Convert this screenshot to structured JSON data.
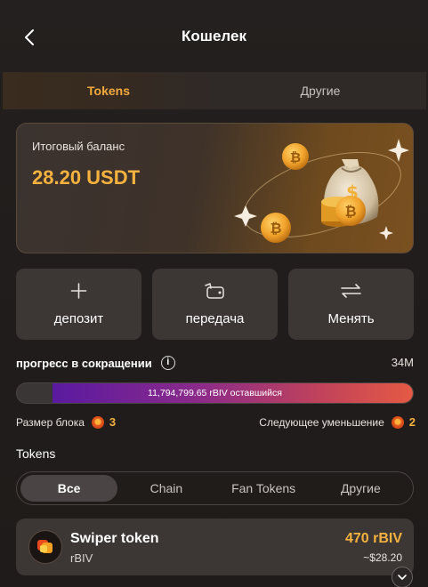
{
  "header": {
    "title": "Кошелек"
  },
  "tabs": [
    {
      "label": "Tokens",
      "active": true
    },
    {
      "label": "Другие",
      "active": false
    }
  ],
  "balance": {
    "label": "Итоговый баланс",
    "value": "28.20 USDT"
  },
  "actions": [
    {
      "label": "депозит",
      "icon": "plus-icon"
    },
    {
      "label": "передача",
      "icon": "transfer-icon"
    },
    {
      "label": "Менять",
      "icon": "swap-icon"
    }
  ],
  "progress": {
    "title": "прогресс в сокращении",
    "total": "34M",
    "remaining_text": "11,794,799.65 rBIV оставшийся",
    "remaining_fraction": 0.91
  },
  "block": {
    "size_label": "Размер блока",
    "size_value": "3",
    "next_label": "Следующее уменьшение",
    "next_value": "2"
  },
  "tokens_section": {
    "heading": "Tokens",
    "filters": [
      {
        "label": "Все",
        "active": true
      },
      {
        "label": "Chain",
        "active": false
      },
      {
        "label": "Fan Tokens",
        "active": false
      },
      {
        "label": "Другие",
        "active": false
      }
    ]
  },
  "token_list": [
    {
      "name": "Swiper token",
      "symbol": "rBIV",
      "amount": "470 rBIV",
      "usd": "~$28.20"
    }
  ],
  "colors": {
    "accent": "#f6b23e",
    "background": "#211d1c",
    "card": "#3c3635"
  }
}
